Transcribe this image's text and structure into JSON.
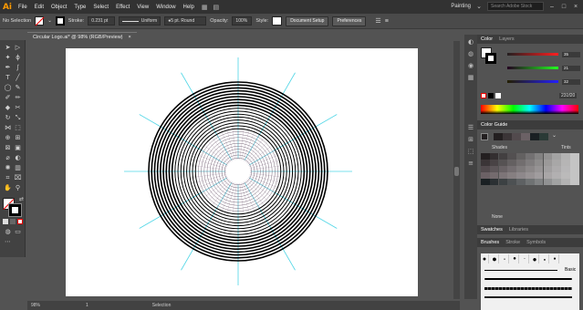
{
  "menubar": {
    "logo": "Ai",
    "items": [
      "File",
      "Edit",
      "Object",
      "Type",
      "Select",
      "Effect",
      "View",
      "Window",
      "Help"
    ],
    "workspace": "Painting",
    "search_placeholder": "Search Adobe Stock"
  },
  "control_bar": {
    "selection_label": "No Selection",
    "stroke_label": "Stroke:",
    "stroke_value": "0.231 pt",
    "profile": "Uniform",
    "brush": "5 pt. Round",
    "opacity_label": "Opacity:",
    "opacity_value": "100%",
    "style_label": "Style:",
    "doc_setup": "Document Setup",
    "preferences": "Preferences"
  },
  "document": {
    "tab_title": "Circular Logo.ai* @ 98% (RGB/Preview)",
    "close": "×"
  },
  "status": {
    "zoom": "98%",
    "page": "1",
    "mode": "Selection"
  },
  "color_panel": {
    "tabs": [
      "Color",
      "Layers"
    ],
    "r": "35",
    "g": "21",
    "b": "32",
    "hex": "231f20"
  },
  "color_guide": {
    "title": "Color Guide",
    "shades_label": "Shades",
    "tints_label": "Tints",
    "none_label": "None"
  },
  "swatches": {
    "tabs": [
      "Swatches",
      "Libraries"
    ],
    "subtabs": [
      "Brushes",
      "Stroke",
      "Symbols"
    ],
    "basic_label": "Basic"
  },
  "colors": {
    "accent": "#ff9a00",
    "stroke": "#000000",
    "guide": "#4fd6e6"
  },
  "icons": [
    "selection-tool",
    "direct-selection-tool",
    "pen-tool",
    "type-tool",
    "line-tool",
    "rectangle-tool",
    "paintbrush-tool",
    "pencil-tool",
    "eraser-tool",
    "rotate-tool",
    "scale-tool",
    "width-tool",
    "free-transform-tool",
    "shape-builder-tool",
    "perspective-tool",
    "mesh-tool",
    "gradient-tool",
    "eyedropper-tool",
    "blend-tool",
    "symbol-sprayer-tool",
    "graph-tool",
    "artboard-tool",
    "slice-tool",
    "hand-tool",
    "zoom-tool"
  ]
}
